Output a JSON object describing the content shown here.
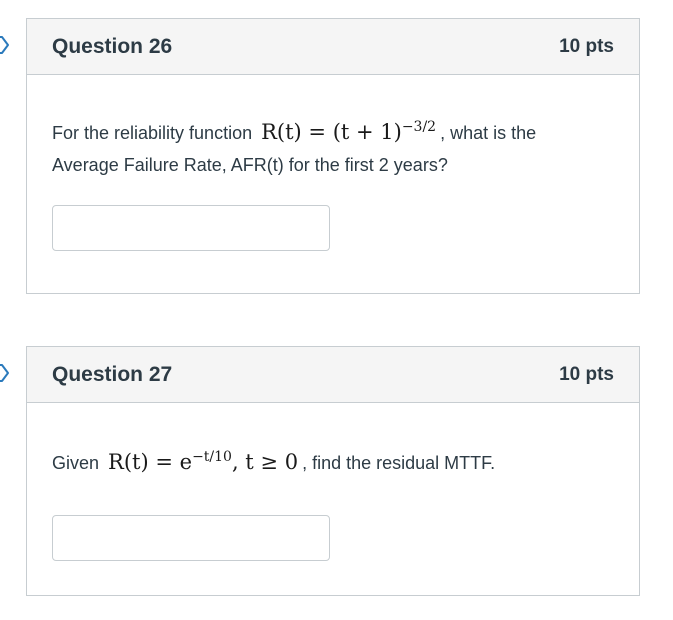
{
  "questions": [
    {
      "title": "Question 26",
      "points": "10 pts",
      "text_before": "For the reliability function",
      "math": {
        "base": "R(t) = (t + 1)",
        "exponent": "−3/2"
      },
      "text_after_line1": ", what is the",
      "text_line2": "Average Failure Rate, AFR(t)  for the first 2 years?",
      "answer": {
        "value": "",
        "placeholder": ""
      }
    },
    {
      "title": "Question 27",
      "points": "10 pts",
      "text_before": "Given",
      "math": {
        "base": "R(t) = e",
        "exponent": "−t/10",
        "tail": ", t ≥ 0"
      },
      "text_after": ", find the residual MTTF.",
      "answer": {
        "value": "",
        "placeholder": ""
      }
    }
  ],
  "colors": {
    "header_bg": "#f5f5f5",
    "border": "#c7cdd1",
    "text": "#2d3b45"
  },
  "icons": {
    "question_marker": "flag-marker-icon"
  }
}
